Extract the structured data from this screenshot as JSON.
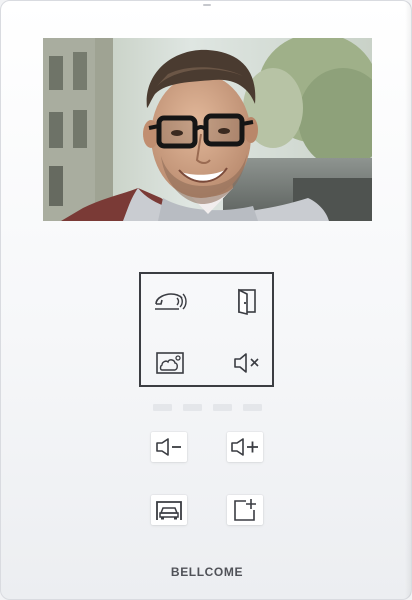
{
  "brand": {
    "name": "BELLCOME"
  },
  "screen": {
    "content": "video-feed"
  },
  "keypad": {
    "keys": [
      {
        "id": "talk",
        "icon": "handset-talk-icon"
      },
      {
        "id": "door",
        "icon": "door-open-icon"
      },
      {
        "id": "gallery",
        "icon": "photo-gallery-icon"
      },
      {
        "id": "mute",
        "icon": "speaker-mute-icon"
      }
    ]
  },
  "indicators": {
    "count": 4,
    "color": "#e4e6ea"
  },
  "buttons": [
    {
      "id": "volume-down",
      "icon": "speaker-minus-icon"
    },
    {
      "id": "volume-up",
      "icon": "speaker-plus-icon"
    },
    {
      "id": "garage",
      "icon": "garage-car-icon"
    },
    {
      "id": "add",
      "icon": "add-frame-icon"
    }
  ],
  "colors": {
    "icon": "#3a3c42",
    "frame": "#3b3d42",
    "body": "#ffffff"
  }
}
